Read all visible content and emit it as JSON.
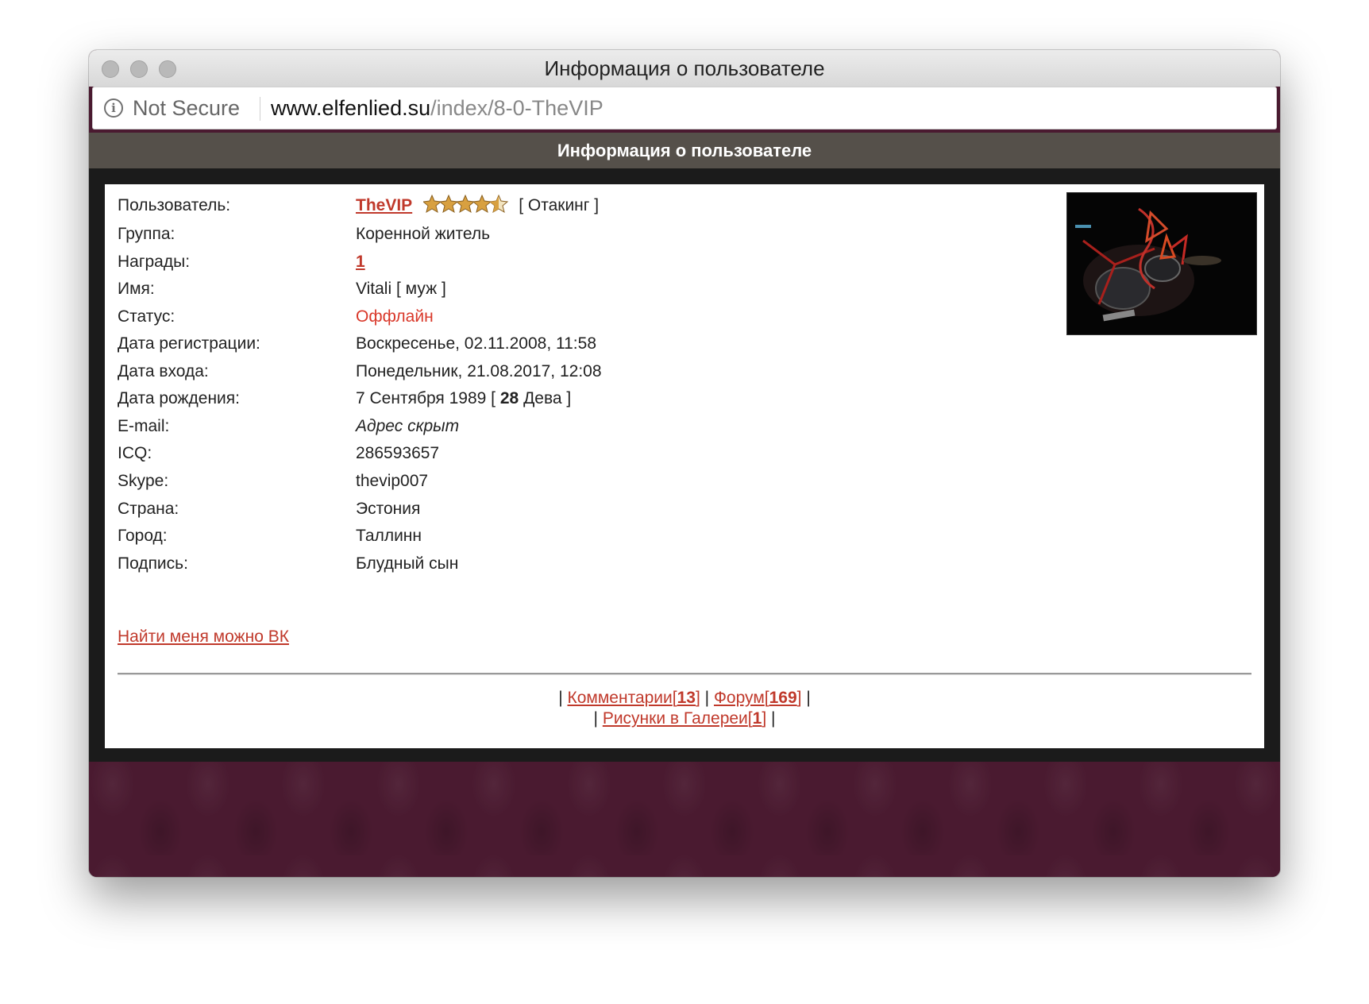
{
  "window": {
    "title": "Информация о пользователе",
    "address_bar": {
      "security_label": "Not Secure",
      "domain": "www.elfenlied.su",
      "path": "/index/8-0-TheVIP"
    }
  },
  "page": {
    "header": "Информация о пользователе",
    "profile": {
      "user_label": "Пользователь:",
      "username": "TheVIP",
      "rank_stars": 4.5,
      "rank": "[ Отакинг ]",
      "group_label": "Группа:",
      "group": "Коренной житель",
      "awards_label": "Награды:",
      "awards": "1",
      "name_label": "Имя:",
      "name": "Vitali",
      "gender": "[ муж ]",
      "status_label": "Статус:",
      "status": "Оффлайн",
      "reg_date_label": "Дата регистрации:",
      "reg_date": "Воскресенье, 02.11.2008, 11:58",
      "login_date_label": "Дата входа:",
      "login_date": "Понедельник, 21.08.2017, 12:08",
      "birth_label": "Дата рождения:",
      "birth_date": "7 Сентября 1989 [",
      "age": "28",
      "zodiac": "Дева ]",
      "email_label": "E-mail:",
      "email": "Адрес скрыт",
      "icq_label": "ICQ:",
      "icq": "286593657",
      "skype_label": "Skype:",
      "skype": "thevip007",
      "country_label": "Страна:",
      "country": "Эстония",
      "city_label": "Город:",
      "city": "Таллинн",
      "signature_label": "Подпись:",
      "signature": "Блудный сын",
      "vk_link": "Найти меня можно ВК"
    },
    "stats": {
      "pipe": "|",
      "comments_label": "Комментарии",
      "comments_count": "13",
      "forum_label": "Форум",
      "forum_count": "169",
      "gallery_label": "Рисунки в Галереи",
      "gallery_count": "1"
    }
  }
}
